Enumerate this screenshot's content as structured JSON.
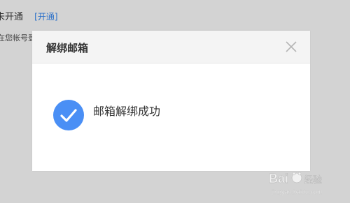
{
  "background": {
    "account_status": "未开通",
    "open_link": "[开通]",
    "account_hint": "在您帐号登"
  },
  "dialog": {
    "title": "解绑邮箱",
    "close_icon": "close-icon",
    "message": "邮箱解绑成功",
    "status_icon": "check-circle-icon",
    "accent_color": "#4a8ff5"
  },
  "watermark": {
    "brand": "Bai",
    "brand2": "du",
    "sub": "经验",
    "url": "jingyan.baidu.com"
  }
}
